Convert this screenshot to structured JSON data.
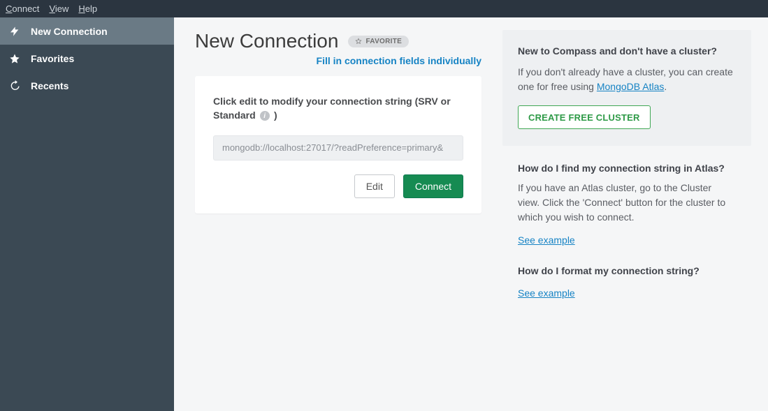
{
  "menubar": {
    "items": [
      {
        "prefix": "C",
        "rest": "onnect"
      },
      {
        "prefix": "V",
        "rest": "iew"
      },
      {
        "prefix": "H",
        "rest": "elp"
      }
    ]
  },
  "sidebar": {
    "items": [
      {
        "label": "New Connection",
        "icon": "bolt-icon",
        "active": true
      },
      {
        "label": "Favorites",
        "icon": "star-icon",
        "active": false
      },
      {
        "label": "Recents",
        "icon": "history-icon",
        "active": false
      }
    ]
  },
  "main": {
    "title": "New Connection",
    "favorite_label": "FAVORITE",
    "fill_link": "Fill in connection fields individually",
    "card": {
      "label_pre": "Click edit to modify your connection string (SRV or Standard ",
      "label_post": ")",
      "placeholder": "mongodb://localhost:27017/?readPreference=primary&",
      "edit_label": "Edit",
      "connect_label": "Connect"
    }
  },
  "help": {
    "box1": {
      "heading": "New to Compass and don't have a cluster?",
      "text_pre": "If you don't already have a cluster, you can create one for free using ",
      "link": "MongoDB Atlas",
      "text_post": ".",
      "cta": "CREATE FREE CLUSTER"
    },
    "q1": {
      "heading": "How do I find my connection string in Atlas?",
      "text": "If you have an Atlas cluster, go to the Cluster view. Click the 'Connect' button for the cluster to which you wish to connect.",
      "link": "See example"
    },
    "q2": {
      "heading": "How do I format my connection string?",
      "link": "See example"
    }
  },
  "colors": {
    "accent_link": "#1683c4",
    "connect_green": "#168b52",
    "outline_green": "#3fa754",
    "sidebar_bg": "#3b4954"
  }
}
